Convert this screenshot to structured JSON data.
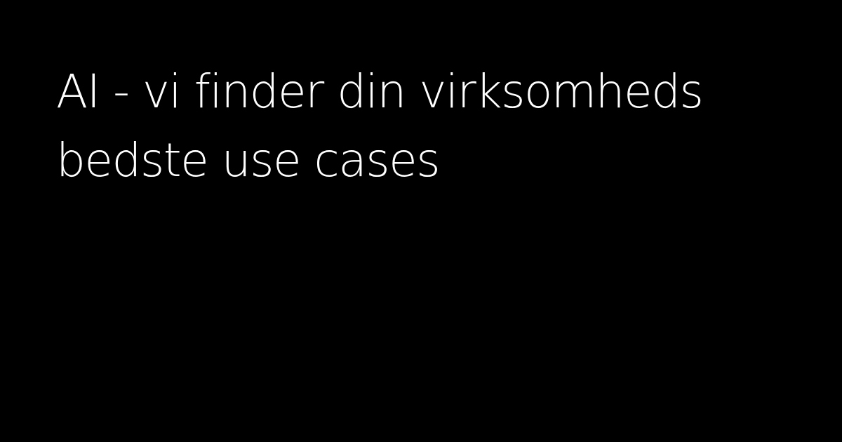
{
  "headline": {
    "line1": "AI - vi finder din virksomheds",
    "line2": "bedste use cases"
  },
  "colors": {
    "background": "#000000",
    "text": "#ffffff"
  }
}
